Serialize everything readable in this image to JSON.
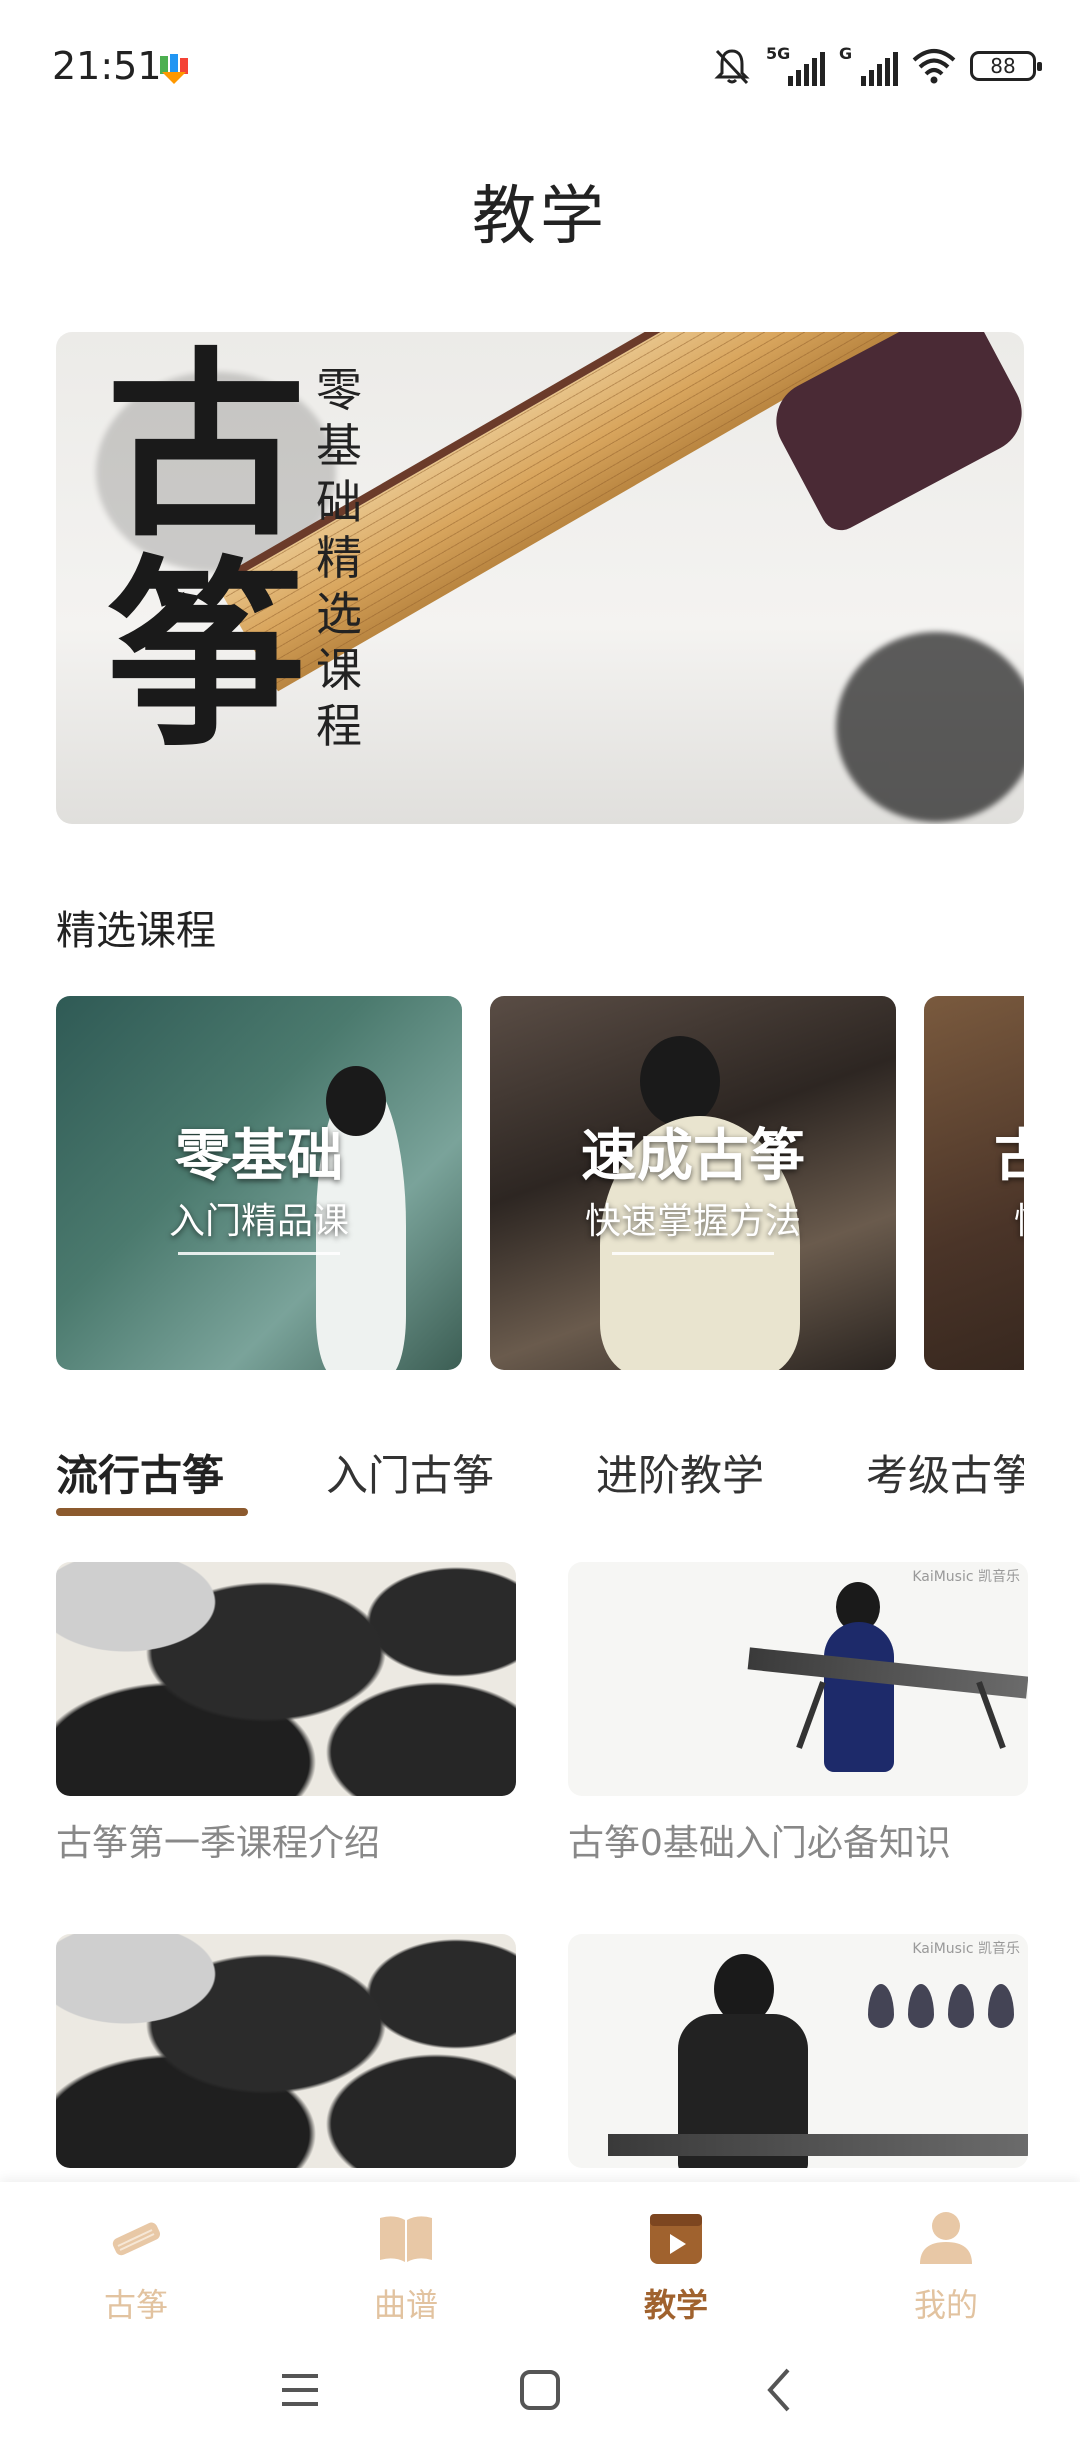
{
  "status_bar": {
    "time": "21:51",
    "network1": "5G",
    "network2": "G",
    "battery": "88"
  },
  "page_title": "教学",
  "banner": {
    "calligraphy": "古筝",
    "vertical_text": "零基础精选课程"
  },
  "featured": {
    "section_title": "精选课程",
    "cards": [
      {
        "title": "零基础",
        "subtitle": "入门精品课"
      },
      {
        "title": "速成古筝",
        "subtitle": "快速掌握方法"
      },
      {
        "title": "古",
        "subtitle": "快"
      }
    ]
  },
  "tabs": [
    {
      "label": "流行古筝",
      "active": true
    },
    {
      "label": "入门古筝",
      "active": false
    },
    {
      "label": "进阶教学",
      "active": false
    },
    {
      "label": "考级古筝",
      "active": false
    }
  ],
  "videos": [
    {
      "title": "古筝第一季课程介绍"
    },
    {
      "title": "古筝0基础入门必备知识",
      "logo": "KaiMusic 凯音乐"
    },
    {
      "title": ""
    },
    {
      "title": "",
      "logo": "KaiMusic 凯音乐"
    }
  ],
  "bottom_nav": [
    {
      "label": "古筝",
      "icon": "guzheng-icon",
      "active": false
    },
    {
      "label": "曲谱",
      "icon": "book-icon",
      "active": false
    },
    {
      "label": "教学",
      "icon": "video-icon",
      "active": true
    },
    {
      "label": "我的",
      "icon": "user-icon",
      "active": false
    }
  ],
  "colors": {
    "accent": "#a0622e",
    "inactive_nav": "#e2c3a0",
    "tab_underline": "#8c5a2e"
  }
}
